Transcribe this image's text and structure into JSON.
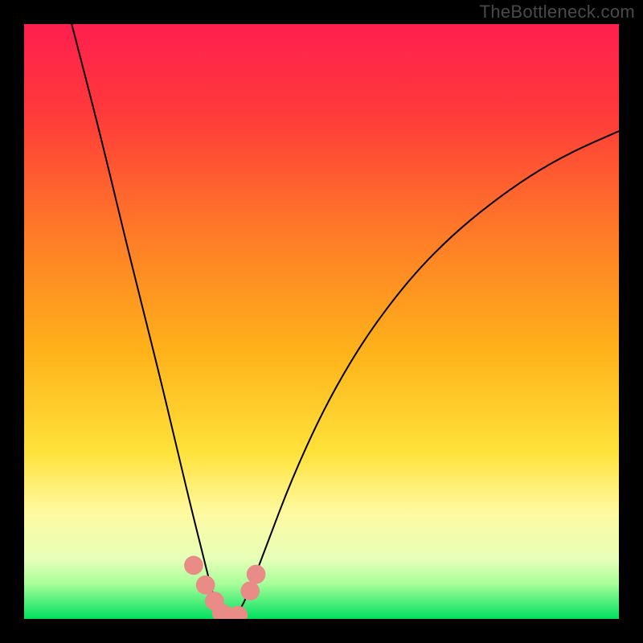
{
  "watermark": "TheBottleneck.com",
  "chart_data": {
    "type": "line",
    "title": "",
    "xlabel": "",
    "ylabel": "",
    "xlim": [
      0,
      100
    ],
    "ylim": [
      0,
      100
    ],
    "grid": false,
    "gradient_stops": [
      {
        "offset": 0.0,
        "color": "#ff1f4f"
      },
      {
        "offset": 0.15,
        "color": "#ff3a3a"
      },
      {
        "offset": 0.35,
        "color": "#ff7a28"
      },
      {
        "offset": 0.55,
        "color": "#ffb21a"
      },
      {
        "offset": 0.72,
        "color": "#ffe23a"
      },
      {
        "offset": 0.82,
        "color": "#fff9a0"
      },
      {
        "offset": 0.9,
        "color": "#e6ffb8"
      },
      {
        "offset": 0.94,
        "color": "#aaff9a"
      },
      {
        "offset": 1.0,
        "color": "#00e060"
      }
    ],
    "series": [
      {
        "name": "bottleneck-curve",
        "stroke": "#000000",
        "points": [
          {
            "x": 8.0,
            "y": 100.0
          },
          {
            "x": 11.0,
            "y": 88.5
          },
          {
            "x": 14.0,
            "y": 76.5
          },
          {
            "x": 17.0,
            "y": 64.0
          },
          {
            "x": 20.0,
            "y": 52.0
          },
          {
            "x": 23.0,
            "y": 40.0
          },
          {
            "x": 25.5,
            "y": 29.5
          },
          {
            "x": 28.0,
            "y": 19.0
          },
          {
            "x": 30.5,
            "y": 9.0
          },
          {
            "x": 32.0,
            "y": 3.0
          },
          {
            "x": 34.0,
            "y": 0.3
          },
          {
            "x": 36.0,
            "y": 0.8
          },
          {
            "x": 38.0,
            "y": 5.0
          },
          {
            "x": 41.0,
            "y": 13.0
          },
          {
            "x": 45.0,
            "y": 23.5
          },
          {
            "x": 50.0,
            "y": 34.5
          },
          {
            "x": 55.0,
            "y": 43.5
          },
          {
            "x": 60.0,
            "y": 51.0
          },
          {
            "x": 66.0,
            "y": 58.5
          },
          {
            "x": 72.0,
            "y": 64.5
          },
          {
            "x": 78.0,
            "y": 69.5
          },
          {
            "x": 85.0,
            "y": 74.5
          },
          {
            "x": 92.0,
            "y": 78.5
          },
          {
            "x": 100.0,
            "y": 82.0
          }
        ]
      }
    ],
    "markers": [
      {
        "x": 28.5,
        "y": 9.0,
        "r": 1.6
      },
      {
        "x": 30.5,
        "y": 5.7,
        "r": 1.6
      },
      {
        "x": 32.0,
        "y": 3.0,
        "r": 1.6
      },
      {
        "x": 33.2,
        "y": 1.0,
        "r": 1.6
      },
      {
        "x": 34.5,
        "y": 0.4,
        "r": 1.6
      },
      {
        "x": 36.0,
        "y": 0.6,
        "r": 1.6
      },
      {
        "x": 38.0,
        "y": 4.7,
        "r": 1.6
      },
      {
        "x": 39.0,
        "y": 7.5,
        "r": 1.6
      }
    ],
    "marker_color": "#e98b87"
  }
}
